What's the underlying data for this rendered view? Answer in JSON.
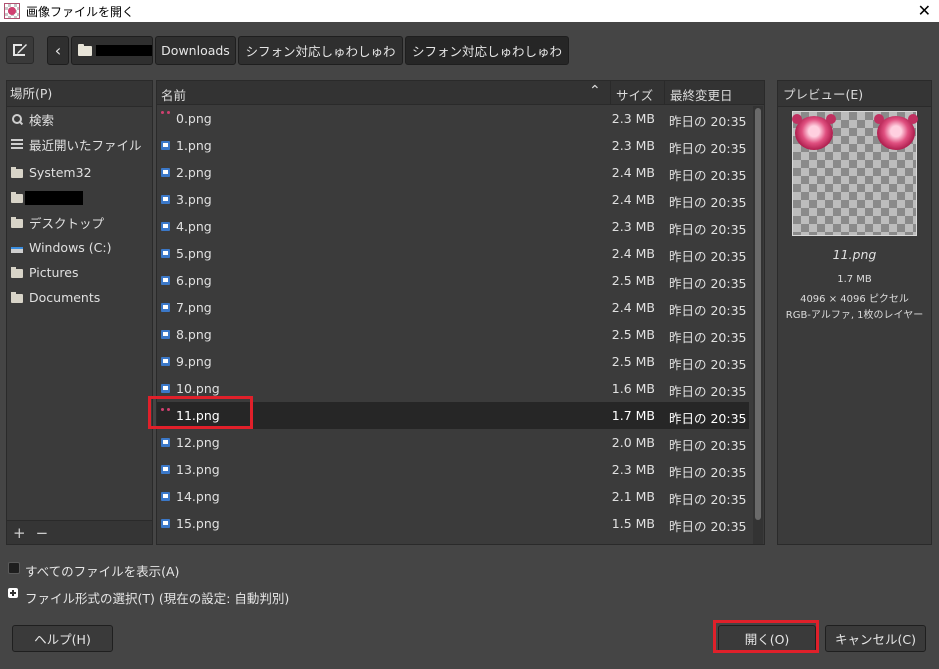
{
  "window": {
    "title": "画像ファイルを開く",
    "close_glyph": "✕"
  },
  "pathbar": {
    "edit_icon": "pencil-edit-icon",
    "back_glyph": "‹",
    "crumbs": [
      "Downloads",
      "シフォン対応しゅわしゅわ",
      "シフォン対応しゅわしゅわ"
    ]
  },
  "places": {
    "header": "場所(P)",
    "items": [
      "検索",
      "最近開いたファイル",
      "System32",
      "",
      "デスクトップ",
      "Windows (C:)",
      "Pictures",
      "Documents"
    ],
    "add_glyph": "+",
    "remove_glyph": "−"
  },
  "filelist": {
    "columns": {
      "name": "名前",
      "size": "サイズ",
      "date": "最終変更日"
    },
    "sort_glyph": "⌃",
    "files": [
      {
        "name": "0.png",
        "size": "2.3 MB",
        "date": "昨日の 20:35"
      },
      {
        "name": "1.png",
        "size": "2.3 MB",
        "date": "昨日の 20:35"
      },
      {
        "name": "2.png",
        "size": "2.4 MB",
        "date": "昨日の 20:35"
      },
      {
        "name": "3.png",
        "size": "2.4 MB",
        "date": "昨日の 20:35"
      },
      {
        "name": "4.png",
        "size": "2.3 MB",
        "date": "昨日の 20:35"
      },
      {
        "name": "5.png",
        "size": "2.4 MB",
        "date": "昨日の 20:35"
      },
      {
        "name": "6.png",
        "size": "2.5 MB",
        "date": "昨日の 20:35"
      },
      {
        "name": "7.png",
        "size": "2.4 MB",
        "date": "昨日の 20:35"
      },
      {
        "name": "8.png",
        "size": "2.5 MB",
        "date": "昨日の 20:35"
      },
      {
        "name": "9.png",
        "size": "2.5 MB",
        "date": "昨日の 20:35"
      },
      {
        "name": "10.png",
        "size": "1.6 MB",
        "date": "昨日の 20:35"
      },
      {
        "name": "11.png",
        "size": "1.7 MB",
        "date": "昨日の 20:35"
      },
      {
        "name": "12.png",
        "size": "2.0 MB",
        "date": "昨日の 20:35"
      },
      {
        "name": "13.png",
        "size": "2.3 MB",
        "date": "昨日の 20:35"
      },
      {
        "name": "14.png",
        "size": "2.1 MB",
        "date": "昨日の 20:35"
      },
      {
        "name": "15.png",
        "size": "1.5 MB",
        "date": "昨日の 20:35"
      }
    ],
    "selected_index": 11
  },
  "preview": {
    "header": "プレビュー(E)",
    "filename": "11.png",
    "size": "1.7 MB",
    "dimensions": "4096 × 4096 ピクセル",
    "mode": "RGB-アルファ, 1枚のレイヤー"
  },
  "options": {
    "show_all_files": "すべてのファイルを表示(A)",
    "file_type": "ファイル形式の選択(T) (現在の設定: 自動判別)"
  },
  "buttons": {
    "help": "ヘルプ(H)",
    "open": "開く(O)",
    "cancel": "キャンセル(C)"
  },
  "colors": {
    "highlight": "#e0202a",
    "file_icon": "#3b78c8",
    "background": "#454545"
  }
}
